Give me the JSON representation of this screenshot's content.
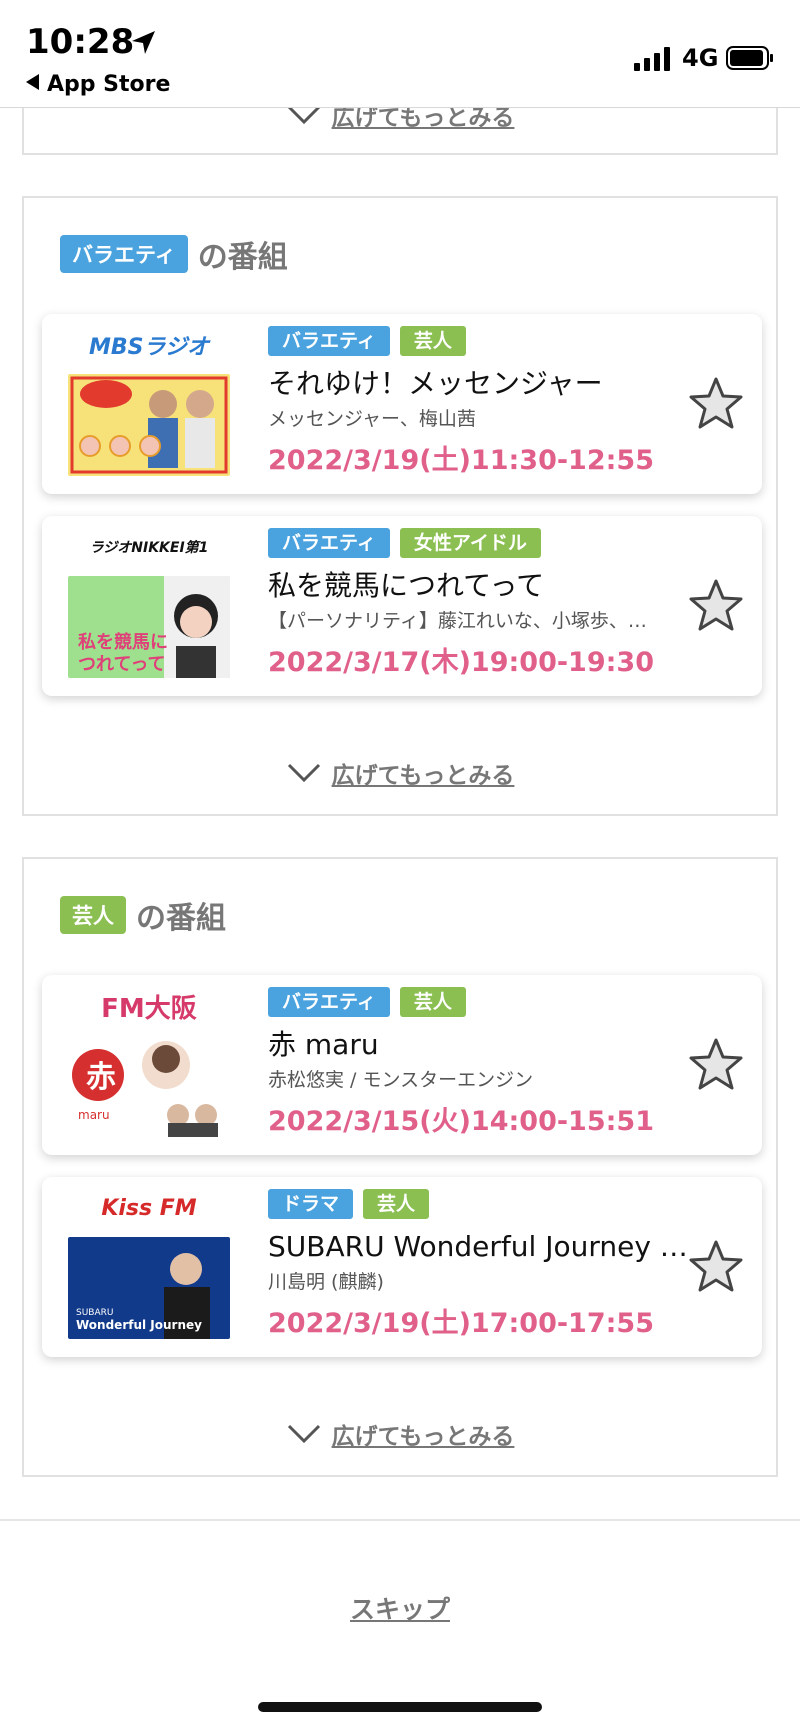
{
  "status_bar": {
    "time": "10:28",
    "back_label": "App Store",
    "network": "4G"
  },
  "more_label": "広げてもっとみる",
  "sections": [
    {
      "tag": "バラエティ",
      "tag_color": "#4aa3df",
      "title": "の番組",
      "cards": [
        {
          "station_logo": "MBSラジオ",
          "tags": [
            {
              "label": "バラエティ",
              "color": "blue"
            },
            {
              "label": "芸人",
              "color": "green"
            }
          ],
          "title": "それゆけ！メッセンジャー",
          "subtitle": "メッセンジャー、梅山茜",
          "date": "2022/3/19(土)11:30-12:55"
        },
        {
          "station_logo": "ラジオNIKKEI第1",
          "tags": [
            {
              "label": "バラエティ",
              "color": "blue"
            },
            {
              "label": "女性アイドル",
              "color": "green"
            }
          ],
          "title": "私を競馬につれてって",
          "subtitle": "【パーソナリティ】藤江れいな、小塚歩、…",
          "date": "2022/3/17(木)19:00-19:30",
          "thumb_text": "私を競馬につれてって"
        }
      ]
    },
    {
      "tag": "芸人",
      "tag_color": "#8bbf52",
      "title": "の番組",
      "cards": [
        {
          "station_logo": "FM大阪",
          "tags": [
            {
              "label": "バラエティ",
              "color": "blue"
            },
            {
              "label": "芸人",
              "color": "green"
            }
          ],
          "title": "赤 maru",
          "subtitle": "赤松悠実 / モンスターエンジン",
          "date": "2022/3/15(火)14:00-15:51",
          "thumb_text": "赤"
        },
        {
          "station_logo": "Kiss FM",
          "tags": [
            {
              "label": "ドラマ",
              "color": "blue"
            },
            {
              "label": "芸人",
              "color": "green"
            }
          ],
          "title": "SUBARU Wonderful Journey 土曜日のエウレカ",
          "subtitle": "川島明 (麒麟)",
          "date": "2022/3/19(土)17:00-17:55",
          "thumb_text": "SUBARU Wonderful Journey"
        }
      ]
    }
  ],
  "skip_label": "スキップ"
}
